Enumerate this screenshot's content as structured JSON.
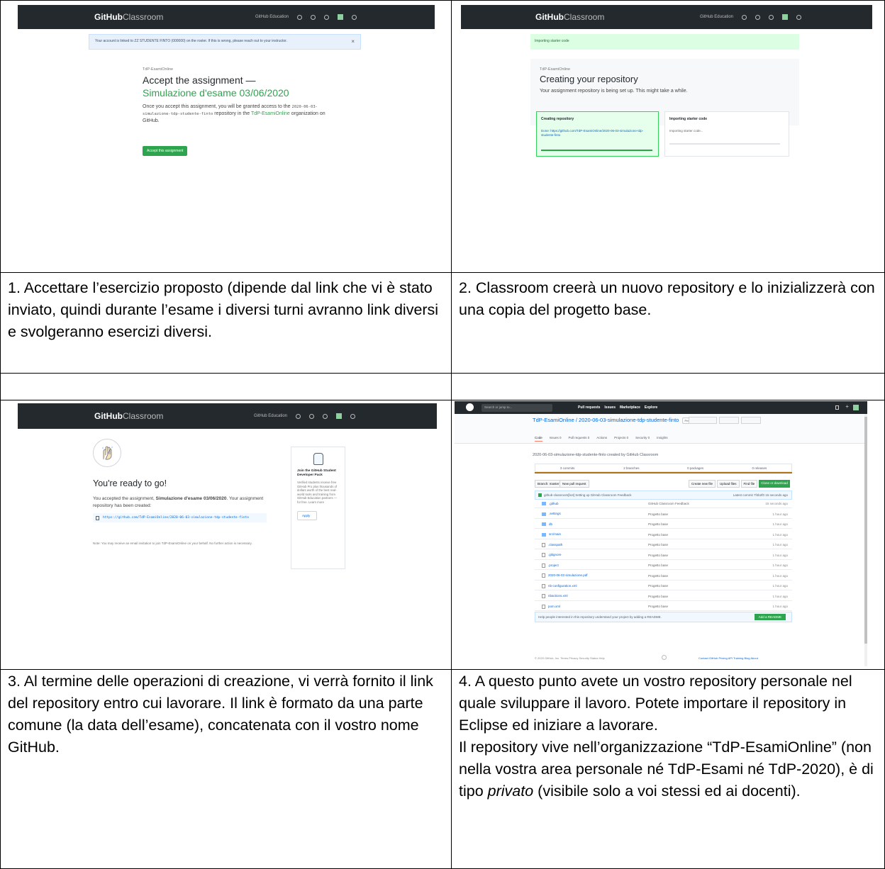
{
  "captions": {
    "c1": "1. Accettare l’esercizio proposto (dipende dal link che vi è stato inviato, quindi durante l’esame i diversi turni avranno link diversi e svolgeranno esercizi diversi.",
    "c2": "2. Classroom creerà un nuovo repository e lo inizializzerà con una copia del progetto base.",
    "c3": "3. Al termine delle operazioni di creazione, vi verrà fornito il link del repository entro cui lavorare. Il link è formato da una parte comune (la data dell’esame), concatenata con il vostro nome GitHub.",
    "c4_p1": "4. A questo punto avete un vostro repository personale nel quale sviluppare il lavoro. Potete importare il repository in Eclipse ed iniziare a lavorare.",
    "c4_p2a": "Il repository vive nell’organizzazione “TdP-EsamiOnline” (non nella vostra area personale né TdP-Esami né TdP-2020), è di tipo ",
    "c4_p2b": "privato",
    "c4_p2c": " (visibile solo a voi stessi ed ai docenti)."
  },
  "classroom": {
    "logo_bold": "GitHub",
    "logo_light": "Classroom",
    "education": "GitHub Education"
  },
  "shot1": {
    "notice": "Your account is linked to ZZ STUDENTE FINTO (000000) on the roster. If this is wrong, please reach out to your instructor.",
    "org_label": "TdP-EsamiOnline",
    "heading": "Accept the assignment —",
    "assignment": "Simulazione d'esame 03/06/2020",
    "body_a": "Once you accept this assignment, you will be granted access to the",
    "body_code": "2020-06-03-simulazione-tdp-studente-finto",
    "body_b": "repository in the",
    "body_link": "TdP-EsamiOnline",
    "body_c": "organization on GitHub.",
    "button": "Accept this assignment"
  },
  "shot2": {
    "banner": "Importing starter code",
    "org_label": "TdP-EsamiOnline",
    "heading": "Creating your repository",
    "sub": "Your assignment repository is being set up. This might take a while.",
    "card1_title": "Creating repository",
    "card1_body": "Done: https://github.com/TdP-EsamiOnline/2020-06-03-simulazione-tdp-studente-finto",
    "card2_title": "Importing starter code",
    "card2_body": "Importing starter code..."
  },
  "shot3": {
    "heading": "You're ready to go!",
    "body_a": "You accepted the assignment,",
    "body_bold": "Simulazione d'esame 03/06/2020",
    "body_b": ". Your assignment repository has been created:",
    "url": "https://github.com/TdP-EsamiOnline/2020-06-03-simulazione-tdp-studente-finto",
    "note": "Note: You may receive an email invitation to join TdP-EsamiOnline on your behalf. No further action is necessary.",
    "pack_title": "Join the GitHub Student Developer Pack",
    "pack_body": "Verified students receive free GitHub Pro plus thousands of dollars worth of the best real-world tools and training from GitHub Education partners — for free. Learn more",
    "apply": "Apply"
  },
  "shot4": {
    "search": "Search or jump to...",
    "nav": [
      "Pull requests",
      "Issues",
      "Marketplace",
      "Explore"
    ],
    "repo_path": "TdP-EsamiOnline / 2020-06-03-simulazione-tdp-studente-finto",
    "private": "Private",
    "tabs": [
      "Code",
      "Issues 0",
      "Pull requests 0",
      "Actions",
      "Projects 0",
      "Security 0",
      "Insights"
    ],
    "description": "2020-06-03-simulazione-tdp-studente-finto created by GitHub Classroom",
    "stats": [
      "3 commits",
      "2 branches",
      "0 packages",
      "0 releases"
    ],
    "branch": "Branch: master",
    "new_pr": "New pull request",
    "actions": [
      "Create new file",
      "Upload files",
      "Find file",
      "Clone or download"
    ],
    "commit_msg": "github-classroom[bot] Setting up GitHub Classroom Feedback",
    "commit_info": "Latest commit 7f4b2f0 15 seconds ago",
    "files": [
      {
        "name": ".github",
        "msg": "GitHub Classroom Feedback",
        "time": "15 seconds ago",
        "dir": true
      },
      {
        "name": ".settings",
        "msg": "Progetto base",
        "time": "1 hour ago",
        "dir": true
      },
      {
        "name": "db",
        "msg": "Progetto base",
        "time": "1 hour ago",
        "dir": true
      },
      {
        "name": "src/main",
        "msg": "Progetto base",
        "time": "1 hour ago",
        "dir": true
      },
      {
        "name": ".classpath",
        "msg": "Progetto base",
        "time": "1 hour ago",
        "dir": false
      },
      {
        "name": ".gitignore",
        "msg": "Progetto base",
        "time": "1 hour ago",
        "dir": false
      },
      {
        "name": ".project",
        "msg": "Progetto base",
        "time": "1 hour ago",
        "dir": false
      },
      {
        "name": "2020-06-03 simulazione.pdf",
        "msg": "Progetto base",
        "time": "1 hour ago",
        "dir": false
      },
      {
        "name": "nb-configuration.xml",
        "msg": "Progetto base",
        "time": "1 hour ago",
        "dir": false
      },
      {
        "name": "nbactions.xml",
        "msg": "Progetto base",
        "time": "1 hour ago",
        "dir": false
      },
      {
        "name": "pom.xml",
        "msg": "Progetto base",
        "time": "1 hour ago",
        "dir": false
      }
    ],
    "readme_hint": "Help people interested in this repository understand your project by adding a README.",
    "add_readme": "Add a README",
    "footer_left": "© 2020 GitHub, Inc.   Terms   Privacy   Security   Status   Help",
    "footer_right": "Contact GitHub   Pricing   API   Training   Blog   About"
  }
}
